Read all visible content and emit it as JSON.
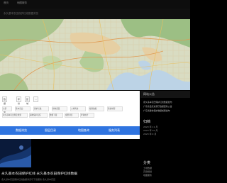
{
  "header": {
    "logo_text": "首页",
    "nav_item": "地图服务",
    "subtitle": "永久基本农田保护红线数据浏览"
  },
  "panel": {
    "tabs": [
      "数据类型",
      "年份",
      "区域",
      "…"
    ],
    "row1": [
      "全部",
      "基本农田",
      "保护红线",
      "耕地质量",
      "土地利用",
      "规划数据",
      "基础地理"
    ],
    "row2": [
      "永久基本农田划定成果",
      "耕地保护责任",
      "数据下载",
      "成果浏览",
      "查询统计"
    ],
    "buttons": [
      "数据浏览",
      "图层目录",
      "地图查询",
      "服务列表"
    ]
  },
  "sidebar": {
    "header": "网站公告",
    "notices": [
      "永久基本农田保护红线数据发布",
      "广东省自然资源厅数据更新公告",
      "广东省耕地保护数据成果发布"
    ],
    "archive_title": "归档",
    "archive": [
      "2023 年 11 月",
      "2023 年 10 月",
      "2023 年 9 月"
    ],
    "category_title": "分类",
    "categories": [
      "土地数据",
      "农田规划",
      "地图服务"
    ]
  },
  "article": {
    "title": "永久基本农田保护红线 永久基本农田保护红线数据",
    "desc": "永久基本农田保护红线数据浏览与下载服务 永久基本农田"
  },
  "colors": {
    "accent": "#2f74e0",
    "background": "#000000"
  }
}
